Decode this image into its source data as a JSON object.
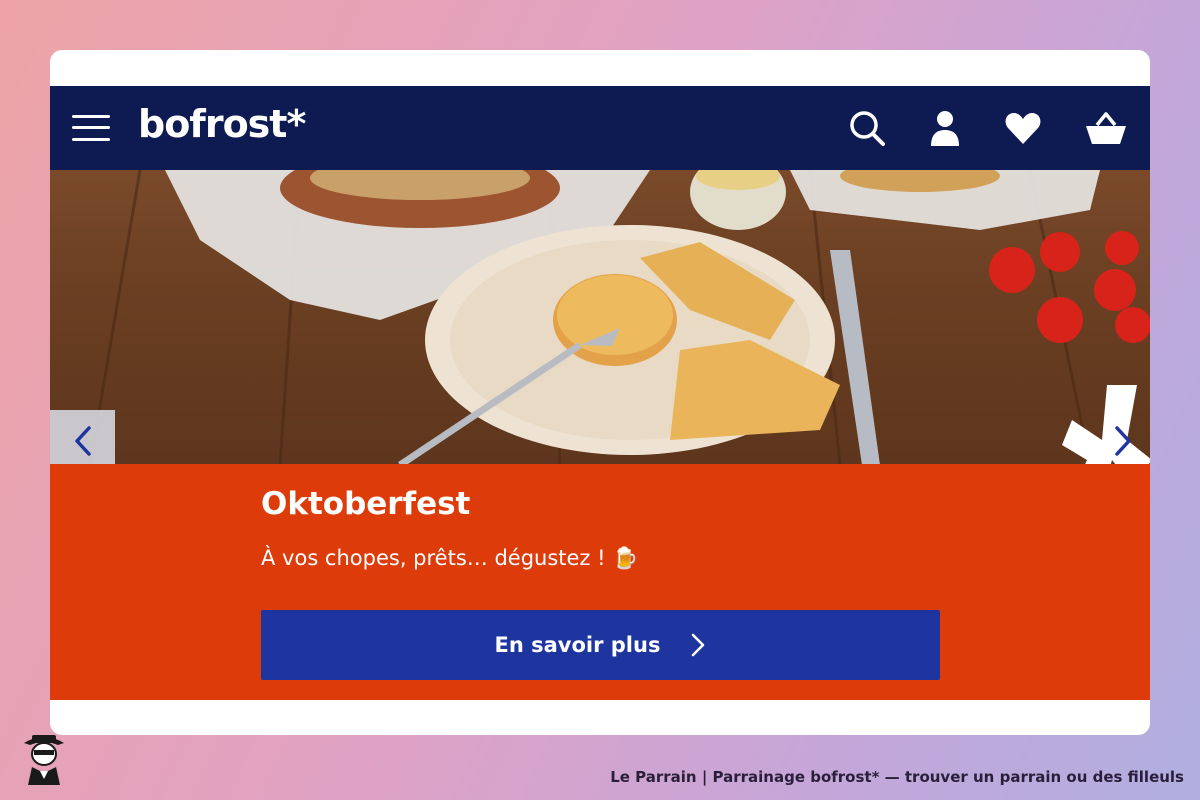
{
  "header": {
    "logo_text": "bofrost*",
    "icons": [
      "menu-icon",
      "search-icon",
      "user-icon",
      "heart-icon",
      "basket-icon"
    ]
  },
  "banner": {
    "title": "Oktoberfest",
    "subtitle": "À vos chopes, prêts… dégustez ! 🍺",
    "cta_label": "En savoir plus"
  },
  "footer": {
    "caption": "Le Parrain | Parrainage bofrost* — trouver un parrain ou des filleuls"
  },
  "colors": {
    "nav": "#0e1b52",
    "banner": "#dd3c0a",
    "cta": "#1e35a0"
  }
}
